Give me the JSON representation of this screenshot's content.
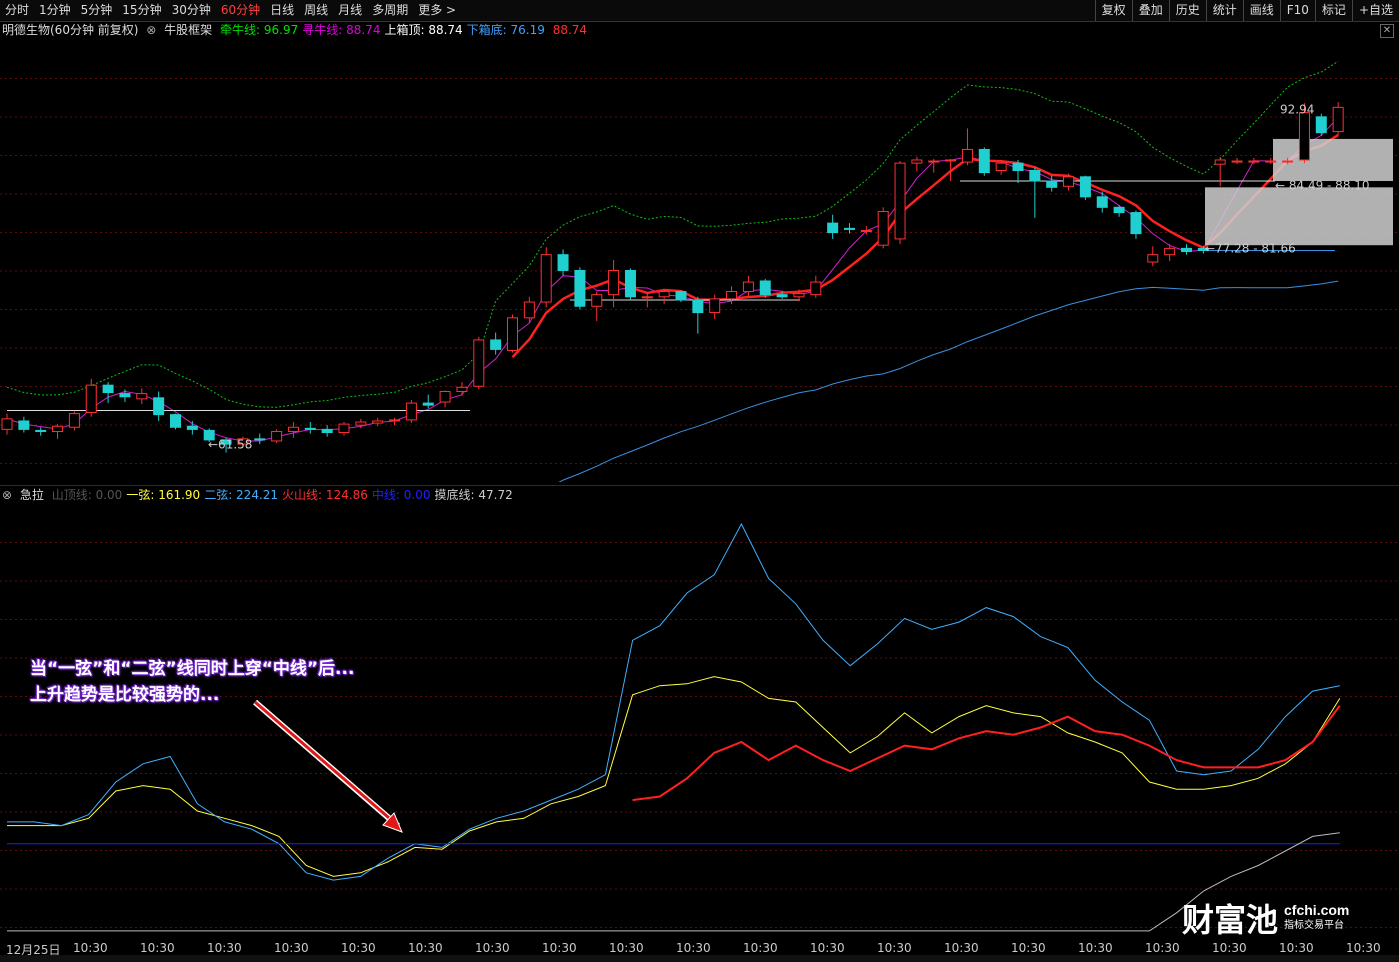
{
  "toolbar": {
    "periods": [
      "分时",
      "1分钟",
      "5分钟",
      "15分钟",
      "30分钟",
      "60分钟",
      "日线",
      "周线",
      "月线",
      "多周期",
      "更多 >"
    ],
    "active_period": "60分钟",
    "right_buttons": [
      "复权",
      "叠加",
      "历史",
      "统计",
      "画线",
      "F10",
      "标记",
      "+自选"
    ]
  },
  "main_legend": {
    "title": "明德生物(60分钟 前复权)",
    "indicator": "牛股框架",
    "items": [
      {
        "label": "牵牛线:",
        "value": "96.97",
        "color": "#00e000"
      },
      {
        "label": "寻牛线:",
        "value": "88.74",
        "color": "#e000e0"
      },
      {
        "label": "上箱顶:",
        "value": "88.74",
        "color": "#ffffff"
      },
      {
        "label": "下箱底:",
        "value": "76.19",
        "color": "#40a0ff"
      },
      {
        "label": "",
        "value": "88.74",
        "color": "#ff3030"
      }
    ]
  },
  "price_labels": {
    "low": "61.58",
    "high": "92.94",
    "box_upper": "84.49 - 88.10",
    "box_lower": "77.28 - 81.66"
  },
  "sub_legend": {
    "name": "急拉",
    "items": [
      {
        "label": "山顶线:",
        "value": "0.00",
        "color": "#555555"
      },
      {
        "label": "一弦:",
        "value": "161.90",
        "color": "#ffff40"
      },
      {
        "label": "二弦:",
        "value": "224.21",
        "color": "#40b0ff"
      },
      {
        "label": "火山线:",
        "value": "124.86",
        "color": "#ff3030"
      },
      {
        "label": "中线:",
        "value": "0.00",
        "color": "#2020ff"
      },
      {
        "label": "摸底线:",
        "value": "47.72",
        "color": "#cccccc"
      }
    ]
  },
  "annotation": {
    "line1": "当“一弦”和“二弦”线同时上穿“中线”后...",
    "line2": "上升趋势是比较强势的..."
  },
  "watermark": {
    "main": "财富池",
    "domain": "cfchi.com",
    "tag": "指标交易平台"
  },
  "x_axis": [
    "12月25日",
    "10:30",
    "10:30",
    "10:30",
    "10:30",
    "10:30",
    "10:30",
    "10:30",
    "10:30",
    "10:30",
    "10:30",
    "10:30",
    "10:30",
    "10:30",
    "10:30",
    "10:30",
    "10:30",
    "10:30",
    "10:30",
    "10:30",
    "10:30"
  ],
  "colors": {
    "up": "#ff3030",
    "down": "#20d0d0",
    "grid": "#6a1010"
  },
  "chart_data": [
    {
      "type": "candlestick",
      "ohlc": [
        [
          63.0,
          64.5,
          62.5,
          64.0
        ],
        [
          63.8,
          64.2,
          62.7,
          63.0
        ],
        [
          62.9,
          63.2,
          62.4,
          62.8
        ],
        [
          62.8,
          63.5,
          62.1,
          63.3
        ],
        [
          63.2,
          64.7,
          62.9,
          64.5
        ],
        [
          64.6,
          67.8,
          64.2,
          67.2
        ],
        [
          67.2,
          67.5,
          65.5,
          66.5
        ],
        [
          66.4,
          66.8,
          65.6,
          66.1
        ],
        [
          65.9,
          66.9,
          65.4,
          66.4
        ],
        [
          66.0,
          66.6,
          63.8,
          64.4
        ],
        [
          64.4,
          64.5,
          63.0,
          63.2
        ],
        [
          63.3,
          63.8,
          62.5,
          63.0
        ],
        [
          62.9,
          63.1,
          61.8,
          62.0
        ],
        [
          62.0,
          62.2,
          60.8,
          61.6
        ],
        [
          61.6,
          62.3,
          61.3,
          62.1
        ],
        [
          62.1,
          62.6,
          61.6,
          62.0
        ],
        [
          61.9,
          63.0,
          61.7,
          62.8
        ],
        [
          62.8,
          63.7,
          62.2,
          63.2
        ],
        [
          63.1,
          63.7,
          62.6,
          63.0
        ],
        [
          63.0,
          63.4,
          62.3,
          62.7
        ],
        [
          62.7,
          63.7,
          62.4,
          63.5
        ],
        [
          63.4,
          64.0,
          63.1,
          63.7
        ],
        [
          63.6,
          64.1,
          63.3,
          63.8
        ],
        [
          63.8,
          64.1,
          63.4,
          63.9
        ],
        [
          63.9,
          65.8,
          63.6,
          65.5
        ],
        [
          65.5,
          66.3,
          65.0,
          65.3
        ],
        [
          65.6,
          66.7,
          65.1,
          66.6
        ],
        [
          66.6,
          67.5,
          66.2,
          67.0
        ],
        [
          67.1,
          71.8,
          66.8,
          71.5
        ],
        [
          71.5,
          72.2,
          70.1,
          70.6
        ],
        [
          70.5,
          73.9,
          70.3,
          73.6
        ],
        [
          73.6,
          75.6,
          73.1,
          75.1
        ],
        [
          75.1,
          80.3,
          74.6,
          79.6
        ],
        [
          79.6,
          80.1,
          77.6,
          78.1
        ],
        [
          78.1,
          78.4,
          74.4,
          74.7
        ],
        [
          74.7,
          76.1,
          73.3,
          75.8
        ],
        [
          75.8,
          79.1,
          74.6,
          78.1
        ],
        [
          78.1,
          78.3,
          75.3,
          75.6
        ],
        [
          75.5,
          76.0,
          74.6,
          75.6
        ],
        [
          75.6,
          76.3,
          74.9,
          76.1
        ],
        [
          76.1,
          76.2,
          75.1,
          75.3
        ],
        [
          75.3,
          75.6,
          72.1,
          74.1
        ],
        [
          74.1,
          75.8,
          73.5,
          75.4
        ],
        [
          75.4,
          76.6,
          74.9,
          76.1
        ],
        [
          76.1,
          77.6,
          75.5,
          77.0
        ],
        [
          77.1,
          77.3,
          75.5,
          75.8
        ],
        [
          75.8,
          76.1,
          75.4,
          75.6
        ],
        [
          75.6,
          76.3,
          75.2,
          75.9
        ],
        [
          75.8,
          77.6,
          75.5,
          77.0
        ],
        [
          82.6,
          83.4,
          81.1,
          81.7
        ],
        [
          82.1,
          82.6,
          81.6,
          82.0
        ],
        [
          81.9,
          82.3,
          81.5,
          81.9
        ],
        [
          80.5,
          84.1,
          80.2,
          83.7
        ],
        [
          81.1,
          88.5,
          80.6,
          88.3
        ],
        [
          88.3,
          88.9,
          87.5,
          88.6
        ],
        [
          88.5,
          88.7,
          87.4,
          88.5
        ],
        [
          88.5,
          88.7,
          86.6,
          88.6
        ],
        [
          88.4,
          91.6,
          88.1,
          89.6
        ],
        [
          89.6,
          89.8,
          87.1,
          87.4
        ],
        [
          87.6,
          88.6,
          87.2,
          88.3
        ],
        [
          88.3,
          88.6,
          86.4,
          87.6
        ],
        [
          87.6,
          87.9,
          83.1,
          86.6
        ],
        [
          86.6,
          87.1,
          85.6,
          86.0
        ],
        [
          86.1,
          87.3,
          85.7,
          87.0
        ],
        [
          87.0,
          87.1,
          84.8,
          85.1
        ],
        [
          85.1,
          85.6,
          83.6,
          84.1
        ],
        [
          84.1,
          84.3,
          83.2,
          83.6
        ],
        [
          83.6,
          83.8,
          81.1,
          81.6
        ],
        [
          78.9,
          80.4,
          78.5,
          79.6
        ],
        [
          79.6,
          80.6,
          79.0,
          80.2
        ],
        [
          80.2,
          80.6,
          79.6,
          79.9
        ],
        [
          80.2,
          80.4,
          79.7,
          80.0
        ],
        [
          88.2,
          88.9,
          86.1,
          88.6
        ],
        [
          88.4,
          88.8,
          88.2,
          88.5
        ],
        [
          88.4,
          88.8,
          88.2,
          88.5
        ],
        [
          88.4,
          88.8,
          88.2,
          88.5
        ],
        [
          88.4,
          88.8,
          88.2,
          88.5
        ],
        [
          88.6,
          94.0,
          88.3,
          93.1
        ],
        [
          92.7,
          93.0,
          90.9,
          91.2
        ],
        [
          91.3,
          94.1,
          91.0,
          93.6
        ]
      ]
    },
    {
      "type": "line",
      "series": [
        {
          "name": "一弦",
          "values": [
            58,
            58,
            58,
            62,
            77,
            80,
            78,
            66,
            62,
            58,
            52,
            36,
            30,
            32,
            38,
            46,
            45,
            55,
            60,
            62,
            70,
            74,
            80,
            130,
            135,
            136,
            140,
            137,
            128,
            126,
            112,
            98,
            107,
            120,
            109,
            118,
            124,
            120,
            118,
            109,
            104,
            98,
            82,
            78,
            78,
            80,
            84,
            92,
            104,
            128
          ]
        },
        {
          "name": "二弦",
          "values": [
            60,
            60,
            58,
            64,
            82,
            92,
            96,
            70,
            60,
            56,
            48,
            32,
            28,
            30,
            40,
            48,
            46,
            56,
            62,
            66,
            72,
            78,
            86,
            160,
            168,
            186,
            196,
            224,
            194,
            180,
            160,
            146,
            158,
            172,
            166,
            170,
            178,
            173,
            162,
            156,
            138,
            126,
            116,
            88,
            86,
            88,
            100,
            118,
            132,
            135
          ]
        },
        {
          "name": "火山线",
          "values": [
            null,
            null,
            null,
            null,
            null,
            null,
            null,
            null,
            null,
            null,
            null,
            null,
            null,
            null,
            null,
            null,
            null,
            null,
            null,
            null,
            null,
            null,
            null,
            72,
            74,
            84,
            98,
            104,
            94,
            102,
            94,
            88,
            95,
            102,
            100,
            106,
            110,
            108,
            112,
            118,
            110,
            108,
            102,
            94,
            90,
            90,
            90,
            94,
            104,
            124
          ]
        },
        {
          "name": "中线",
          "values": [
            48,
            48,
            48,
            48,
            48,
            48,
            48,
            48,
            48,
            48,
            48,
            48,
            48,
            48,
            48,
            48,
            48,
            48,
            48,
            48,
            48,
            48,
            48,
            48,
            48,
            48,
            48,
            48,
            48,
            48,
            48,
            48,
            48,
            48,
            48,
            48,
            48,
            48,
            48,
            48,
            48,
            48,
            48,
            48,
            48,
            48,
            48,
            48,
            48,
            48
          ]
        },
        {
          "name": "摸底线",
          "values": [
            0,
            0,
            0,
            0,
            0,
            0,
            0,
            0,
            0,
            0,
            0,
            0,
            0,
            0,
            0,
            0,
            0,
            0,
            0,
            0,
            0,
            0,
            0,
            0,
            0,
            0,
            0,
            0,
            0,
            0,
            0,
            0,
            0,
            0,
            0,
            0,
            0,
            0,
            0,
            0,
            0,
            0,
            0,
            10,
            22,
            30,
            36,
            44,
            52,
            54
          ]
        }
      ]
    }
  ]
}
